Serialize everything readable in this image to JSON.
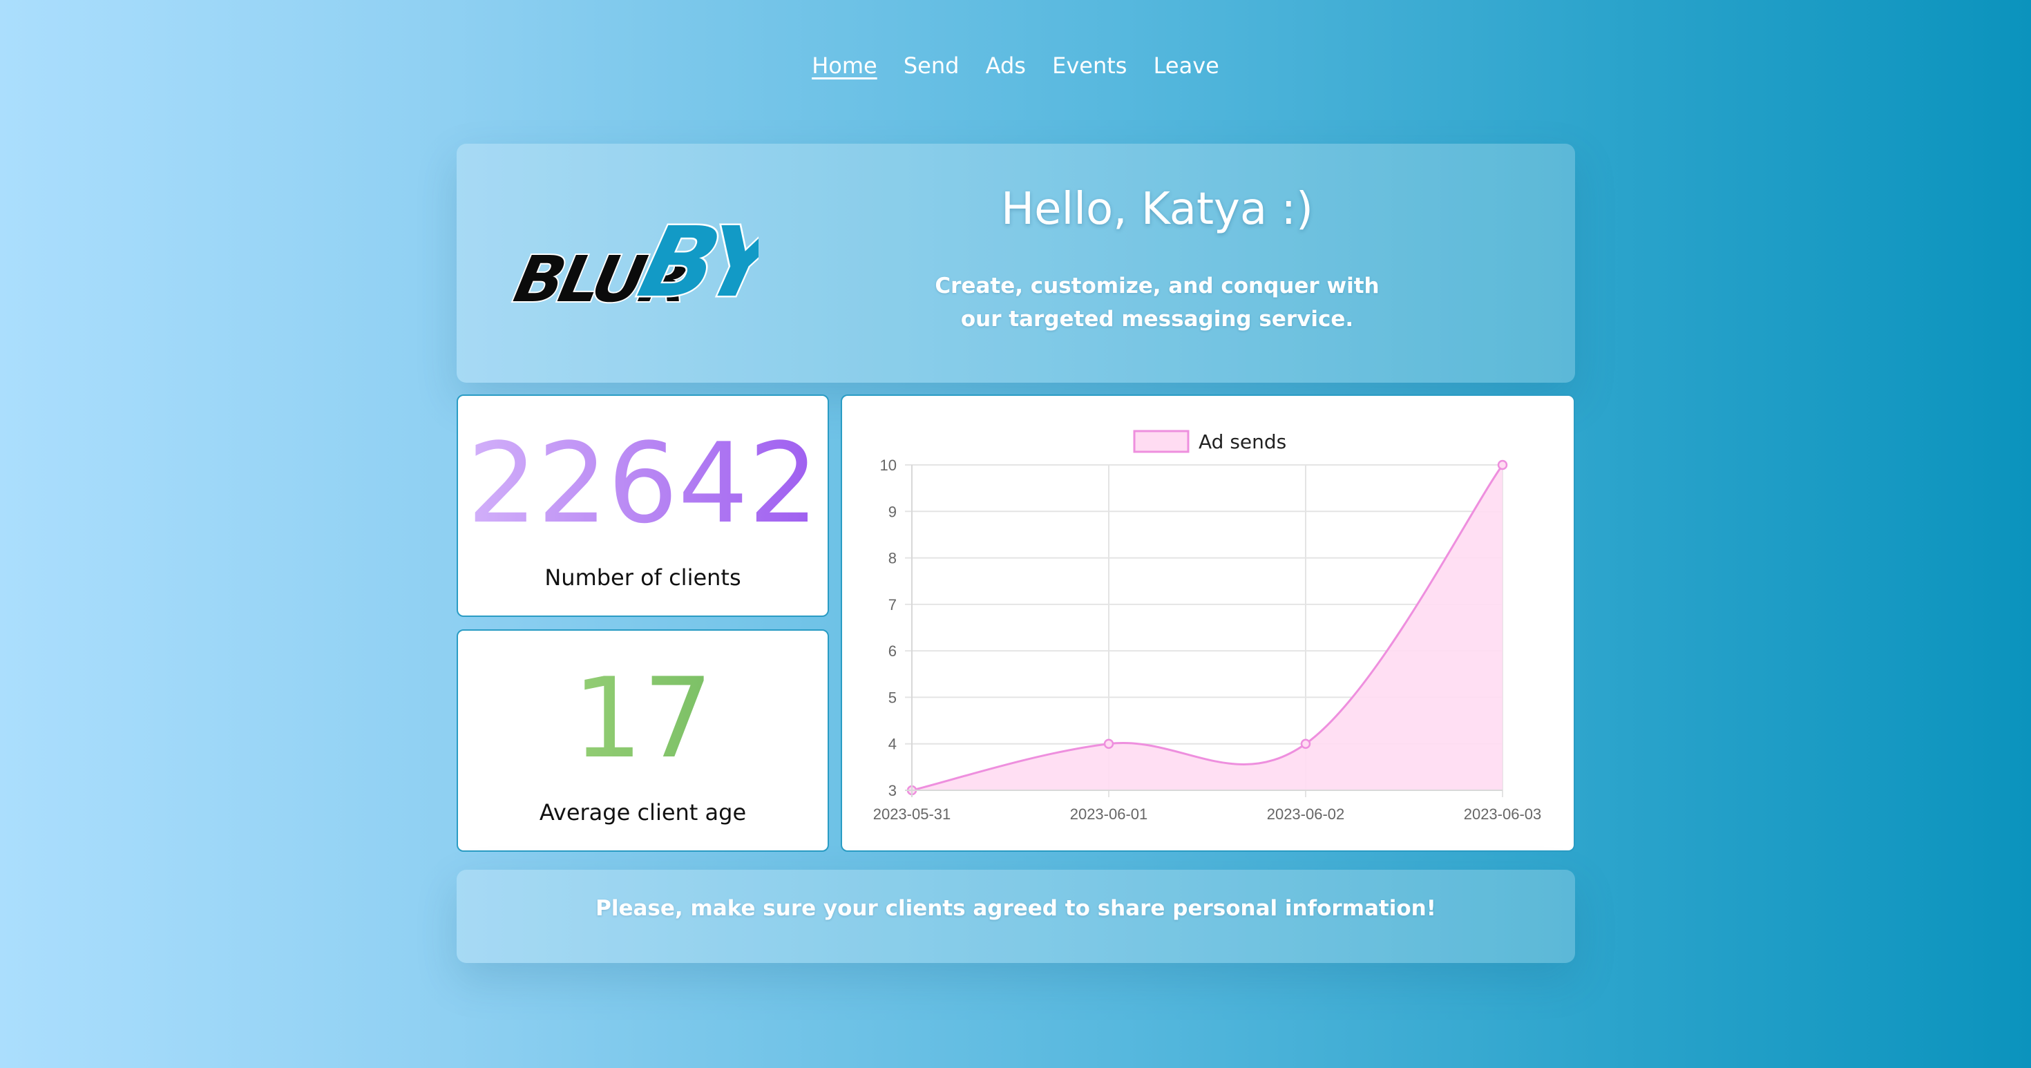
{
  "nav": {
    "items": [
      {
        "label": "Home",
        "active": true
      },
      {
        "label": "Send",
        "active": false
      },
      {
        "label": "Ads",
        "active": false
      },
      {
        "label": "Events",
        "active": false
      },
      {
        "label": "Leave",
        "active": false
      }
    ]
  },
  "logo": {
    "text_dark": "BLUR",
    "text_accent": "BY",
    "accent_color": "#129ac6"
  },
  "hero": {
    "greeting": "Hello, Katya :)",
    "subtitle_line1": "Create, customize, and conquer with",
    "subtitle_line2": "our targeted messaging service."
  },
  "stats": {
    "clients": {
      "value": "22642",
      "label": "Number of clients"
    },
    "age": {
      "value": "17",
      "label": "Average client age"
    }
  },
  "chart_data": {
    "type": "area",
    "title": "",
    "xlabel": "",
    "ylabel": "",
    "x": [
      "2023-05-31",
      "2023-06-01",
      "2023-06-02",
      "2023-06-03"
    ],
    "series": [
      {
        "name": "Ad sends",
        "values": [
          3,
          4,
          4,
          10
        ]
      }
    ],
    "ylim": [
      3,
      10
    ],
    "yticks": [
      3,
      4,
      5,
      6,
      7,
      8,
      9,
      10
    ],
    "grid": true,
    "legend": "top-center",
    "line_color": "#ee8fde",
    "fill_color": "#ffdcf2"
  },
  "footer": {
    "notice": "Please, make sure your clients agreed to share personal information!"
  }
}
